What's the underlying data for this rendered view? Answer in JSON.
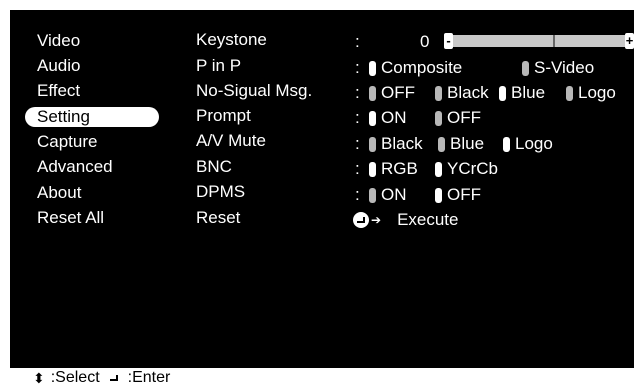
{
  "menu": {
    "items": [
      {
        "label": "Video"
      },
      {
        "label": "Audio"
      },
      {
        "label": "Effect"
      },
      {
        "label": "Setting"
      },
      {
        "label": "Capture"
      },
      {
        "label": "Advanced"
      },
      {
        "label": "About"
      },
      {
        "label": "Reset All"
      }
    ],
    "selected_index": 3
  },
  "settings": {
    "keystone": {
      "label": "Keystone",
      "value": "0",
      "fraction": 0.58,
      "left_glyph": "-",
      "right_glyph": "+"
    },
    "pinp": {
      "label": "P in P",
      "opt1": "Composite",
      "opt2": "S-Video"
    },
    "nosignal": {
      "label": "No-Sigual Msg.",
      "opt1": "OFF",
      "opt2": "Black",
      "opt3": "Blue",
      "opt4": "Logo"
    },
    "prompt": {
      "label": "Prompt",
      "opt1": "ON",
      "opt2": "OFF"
    },
    "avmute": {
      "label": "A/V Mute",
      "opt1": "Black",
      "opt2": "Blue",
      "opt3": "Logo"
    },
    "bnc": {
      "label": "BNC",
      "opt1": "RGB",
      "opt2": "YCrCb"
    },
    "dpms": {
      "label": "DPMS",
      "opt1": "ON",
      "opt2": "OFF"
    },
    "reset": {
      "label": "Reset",
      "action": "Execute"
    }
  },
  "colon": ":",
  "footer": {
    "select_label": ":Select",
    "enter_label": ":Enter"
  }
}
